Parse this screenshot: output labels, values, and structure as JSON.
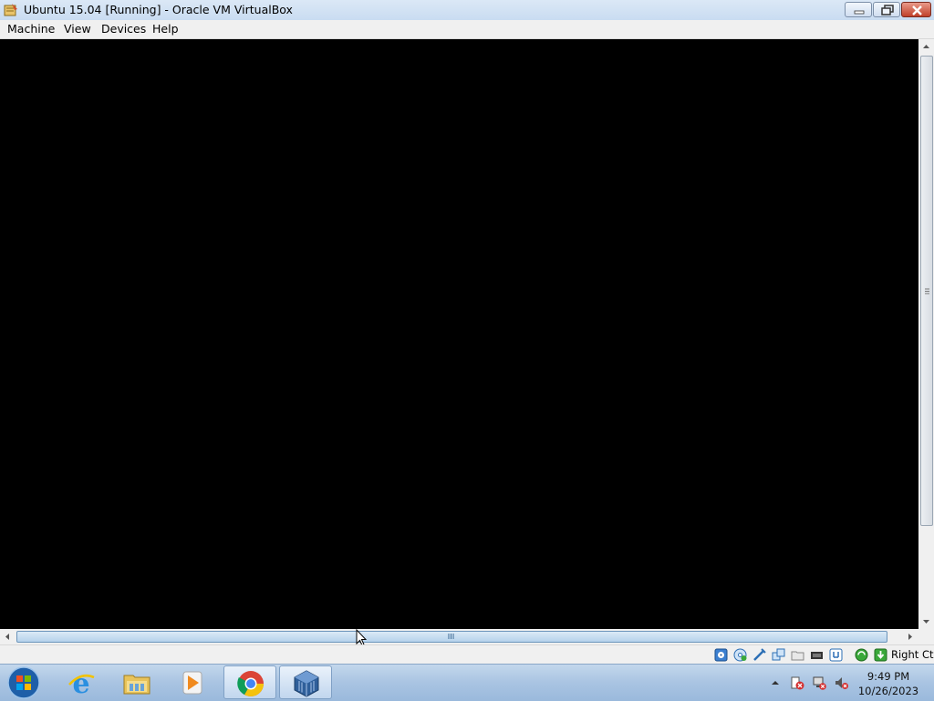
{
  "window": {
    "title": "Ubuntu 15.04 [Running] - Oracle VM VirtualBox"
  },
  "menu": {
    "items": [
      {
        "label": "Machine"
      },
      {
        "label": "View"
      },
      {
        "label": "Devices"
      },
      {
        "label": "Help"
      }
    ]
  },
  "statusbar": {
    "icons": [
      "hard-disk-icon",
      "optical-drive-icon",
      "usb-icon",
      "shared-folders-icon",
      "display-icon",
      "video-capture-icon",
      "network-icon",
      "cpu-icon",
      "mouse-integration-icon",
      "host-key-icon"
    ],
    "host_key": "Right Ctrl"
  },
  "taskbar": {
    "items": [
      "internet-explorer-icon",
      "file-explorer-icon",
      "media-player-icon",
      "chrome-icon",
      "virtualbox-icon"
    ],
    "tray_icons": [
      "show-hidden-icons-chevron",
      "action-center-warning-icon",
      "network-disconnected-icon",
      "volume-muted-icon"
    ],
    "time": "9:49 PM",
    "date": "10/26/2023"
  },
  "colors": {
    "vm_screen": "#000000",
    "taskbar": "#a9c4e2",
    "titlebar": "#c9dcf1"
  }
}
